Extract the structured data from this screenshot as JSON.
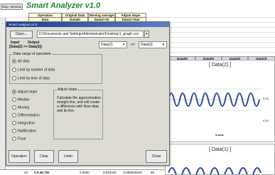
{
  "app": {
    "display_window_label": "Disp. Window",
    "title": "Smart Analyzer v1.0"
  },
  "sheet": {
    "header_row1": [
      "Operation",
      "Original Data",
      "Moving average",
      "Adjust slope"
    ],
    "header_row2": [
      "Data",
      "Data00",
      "Data0>>D",
      "Data2>>Dat"
    ],
    "column_headers": [
      "Data(6)",
      "Data(5)",
      "Data(4)",
      "Data(3)"
    ],
    "bottom_row": {
      "row_no": "20",
      "time": "0.0:46.700",
      "v1": "0.6900",
      "v2": "0.640325",
      "v3": "-2.999300000",
      "v4": "88"
    }
  },
  "charts": {
    "chart1_title": "[ Data(2) ]",
    "chart1_xlabel": "X-axis",
    "chart1_yticks": [
      "0.03",
      "0.00"
    ],
    "chart2_title": "[ Data(1) ]"
  },
  "chart_data": [
    {
      "type": "line",
      "title": "[ Data(2) ]",
      "xlabel": "X-axis",
      "series": [
        {
          "color": "#2b4c9b",
          "shape": "oscillating waveform"
        }
      ]
    },
    {
      "type": "line",
      "title": "[ Data(1) ]",
      "series": [
        {
          "color": "#2b4c9b",
          "shape": "oscillating waveform"
        }
      ]
    }
  ],
  "dialog": {
    "title": "Smart Analyzer v1.0",
    "open_button": "Open...",
    "file_path": "D:\\Documents and Settings\\Administrator\\Desktop\\1_graph.csv",
    "input_label": "Input",
    "output_label": "Output",
    "mapping_label": "[Data(2) >> Data(3)]",
    "input_select": "Data(2)",
    "arrow_label": ">>",
    "output_select": "Data(3)",
    "range_group_label": "Data range of operation",
    "range_options": [
      "All data",
      "Limit by number of data",
      "Limit by time of data"
    ],
    "range_selected_index": 0,
    "operation_options": [
      "Adjust slope",
      "Median",
      "Moving",
      "Differentiation",
      "Integration",
      "Nultification",
      "Fourr"
    ],
    "operation_selected_index": 0,
    "adjust_group_label": "Adjust slope",
    "adjust_description": "Calculate the approximation straight line, and will create a difference with Now data and its line.",
    "operation_button": "Operation",
    "clear_button": "Clear",
    "undo_button": "Undo",
    "close_button": "Close"
  },
  "colors": {
    "title_green": "#1f8a2e",
    "dialog_bg": "#dcdcd4",
    "title_bar": "#1a3d8f",
    "wave": "#2b4c9b",
    "header_yellow": "#fffbd6"
  }
}
